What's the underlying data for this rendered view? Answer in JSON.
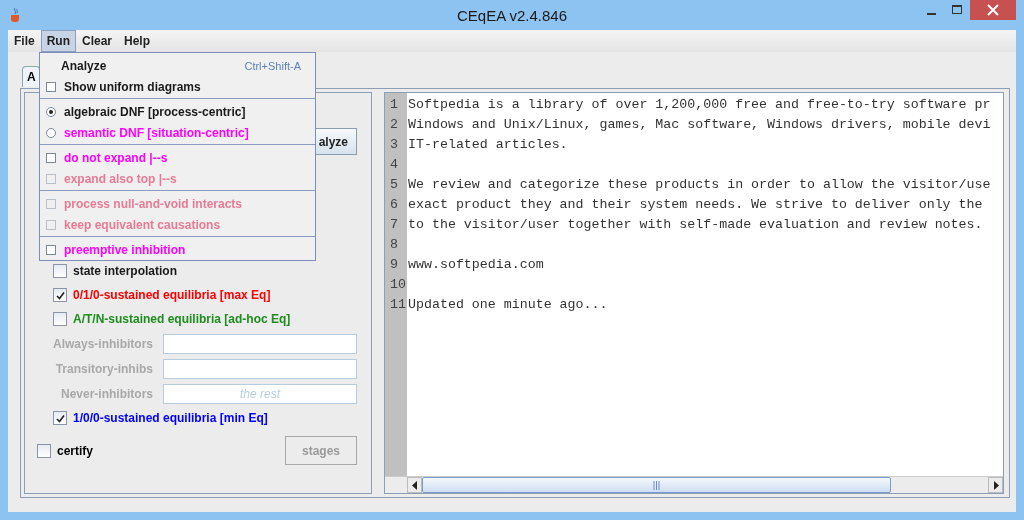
{
  "window": {
    "title": "CEqEA v2.4.846"
  },
  "menubar": [
    {
      "label": "File",
      "selected": false
    },
    {
      "label": "Run",
      "selected": true
    },
    {
      "label": "Clear",
      "selected": false
    },
    {
      "label": "Help",
      "selected": false
    }
  ],
  "run_menu": {
    "groups": [
      [
        {
          "kind": "item",
          "label": "Analyze",
          "shortcut": "Ctrl+Shift-A",
          "disabled": false,
          "color": "#1a1a1a"
        },
        {
          "kind": "check",
          "label": "Show uniform diagrams",
          "checked": false,
          "disabled": false,
          "color": "#1a1a1a"
        }
      ],
      [
        {
          "kind": "radio",
          "label": "algebraic DNF [process-centric]",
          "selected": true,
          "disabled": false,
          "color": "#1a1a1a"
        },
        {
          "kind": "radio",
          "label": "semantic DNF [situation-centric]",
          "selected": false,
          "disabled": false,
          "color": "#ff00ff"
        }
      ],
      [
        {
          "kind": "check",
          "label": "do not expand |--s",
          "checked": false,
          "disabled": false,
          "color": "#ff00ff"
        },
        {
          "kind": "check",
          "label": "expand also top |--s",
          "checked": false,
          "disabled": true,
          "color": "#e77a94"
        }
      ],
      [
        {
          "kind": "check",
          "label": "process null-and-void interacts",
          "checked": false,
          "disabled": true,
          "color": "#e77a94"
        },
        {
          "kind": "check",
          "label": "keep equivalent causations",
          "checked": false,
          "disabled": true,
          "color": "#e77a94"
        }
      ],
      [
        {
          "kind": "check",
          "label": "preemptive inhibition",
          "checked": false,
          "disabled": false,
          "color": "#ff00ff"
        }
      ]
    ]
  },
  "tabs": [
    {
      "label": "A",
      "selected": true
    }
  ],
  "left_panel": {
    "analyze_button": "alyze",
    "options": [
      {
        "kind": "check",
        "label": "state interpolation",
        "checked": false,
        "color": "#1a1a1a"
      },
      {
        "kind": "check",
        "label": "0/1/0-sustained equilibria [max Eq]",
        "checked": true,
        "color": "#ff0000"
      },
      {
        "kind": "check",
        "label": "A/T/N-sustained equilibria [ad-hoc Eq]",
        "checked": false,
        "color": "#1e8c1e"
      },
      {
        "kind": "field",
        "label": "Always-inhibitors",
        "disabled": true
      },
      {
        "kind": "field",
        "label": "Transitory-inhibs",
        "disabled": true
      },
      {
        "kind": "field",
        "label": "Never-inhibitors",
        "placeholder": "the rest",
        "disabled": true
      },
      {
        "kind": "check",
        "label": "1/0/0-sustained equilibria [min Eq]",
        "checked": true,
        "color": "#0000ff"
      }
    ],
    "certify": {
      "label": "certify",
      "checked": false
    },
    "stages_button": {
      "label": "stages",
      "disabled": true
    }
  },
  "editor": {
    "lines": [
      {
        "number": "1",
        "text": "Softpedia is a library of over 1,200,000 free and free-to-try software pr"
      },
      {
        "number": "2",
        "text": "Windows and Unix/Linux, games, Mac software, Windows drivers, mobile devi"
      },
      {
        "number": "3",
        "text": "IT-related articles."
      },
      {
        "number": "4"
      },
      {
        "number": "5",
        "text": "We review and categorize these products in order to allow the visitor/use"
      },
      {
        "number": "6",
        "text": "exact product they and their system needs. We strive to deliver only the"
      },
      {
        "number": "7",
        "text": "to the visitor/user together with self-made evaluation and review notes."
      },
      {
        "number": "8"
      },
      {
        "number": "9",
        "text": "www.softpedia.com"
      },
      {
        "number": "10"
      },
      {
        "number": "11",
        "text": "Updated one minute ago..."
      }
    ]
  }
}
